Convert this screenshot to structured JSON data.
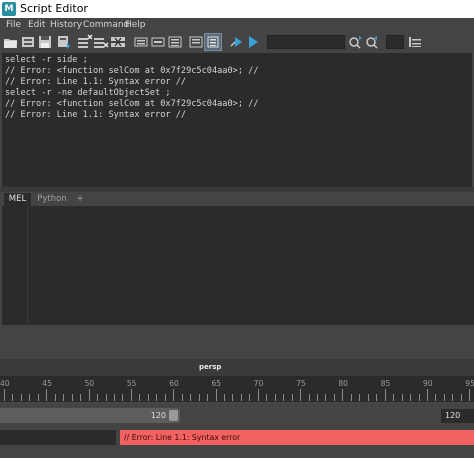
{
  "window": {
    "title": "Script Editor",
    "app_icon": "maya-icon",
    "app_icon_letter": "M"
  },
  "menu": [
    "File",
    "Edit",
    "History",
    "Command",
    "Help"
  ],
  "toolbar": {
    "buttons": [
      "open-script-icon",
      "source-script-icon",
      "save-script-icon",
      "save-script-to-shelf-icon",
      "clear-history-icon",
      "clear-input-icon",
      "clear-all-icon",
      "echo-all-commands-icon",
      "show-line-numbers-icon",
      "show-stack-trace-icon",
      "history-output-icon",
      "execute-selected-icon",
      "execute-all-icon",
      "search-next-icon",
      "search-prev-icon",
      "show-quick-help-icon"
    ],
    "search_value": "",
    "colors": {
      "accent": "#3aa0d8",
      "execute": "#3aa0d8"
    }
  },
  "history": {
    "lines": [
      "select -r side ;",
      "// Error: <function selCom at 0x7f29c5c04aa0>; //",
      "// Error: Line 1.1: Syntax error //",
      "select -r -ne defaultObjectSet ;",
      "// Error: <function selCom at 0x7f29c5c04aa0>; //",
      "// Error: Line 1.1: Syntax error //"
    ]
  },
  "tabs": [
    {
      "label": "MEL",
      "active": true
    },
    {
      "label": "Python",
      "active": false
    },
    {
      "label": "+",
      "active": false
    }
  ],
  "viewport": {
    "camera": "persp"
  },
  "timeline": {
    "ticks": [
      "40",
      "45",
      "50",
      "55",
      "60",
      "65",
      "70",
      "75",
      "80",
      "85",
      "90",
      "95"
    ]
  },
  "range": {
    "end_value": "120",
    "end_field": "120"
  },
  "command_line": {
    "value": "",
    "result": "// Error: Line 1.1: Syntax error",
    "result_color": "#f26260"
  }
}
